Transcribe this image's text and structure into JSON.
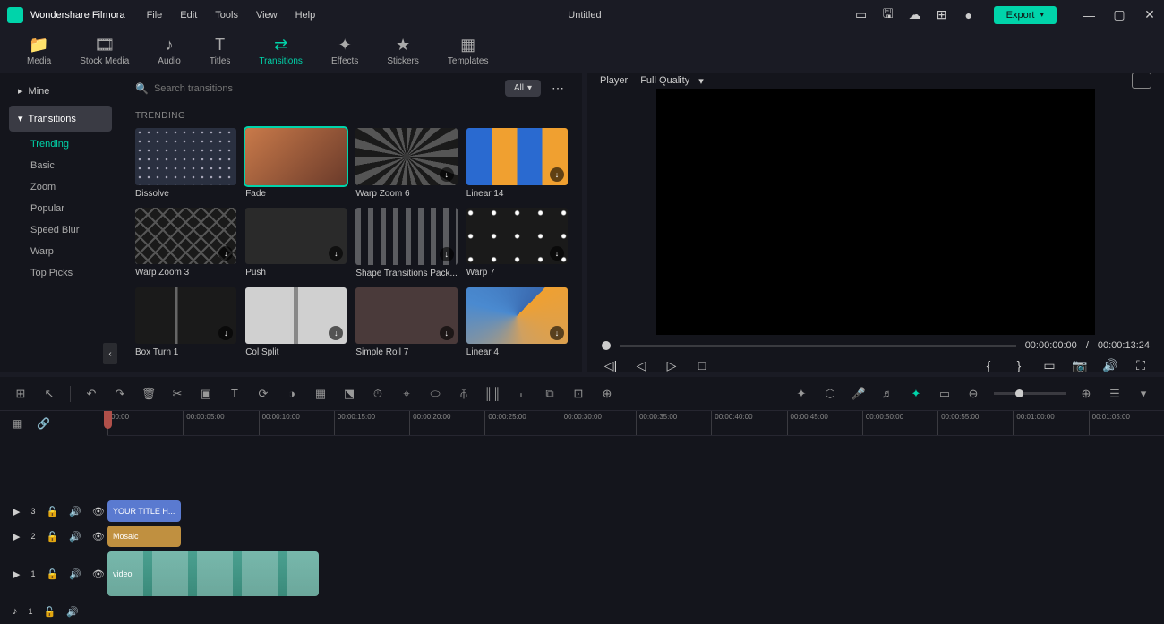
{
  "app": {
    "name": "Wondershare Filmora",
    "title": "Untitled",
    "export": "Export"
  },
  "menus": [
    "File",
    "Edit",
    "Tools",
    "View",
    "Help"
  ],
  "tabs": [
    "Media",
    "Stock Media",
    "Audio",
    "Titles",
    "Transitions",
    "Effects",
    "Stickers",
    "Templates"
  ],
  "active_tab": "Transitions",
  "sidebar": {
    "groups": [
      "Mine",
      "Transitions"
    ],
    "active_group": "Transitions",
    "subs": [
      "Trending",
      "Basic",
      "Zoom",
      "Popular",
      "Speed Blur",
      "Warp",
      "Top Picks"
    ],
    "active_sub": "Trending"
  },
  "search": {
    "placeholder": "Search transitions"
  },
  "filter": {
    "label": "All"
  },
  "section_title": "TRENDING",
  "selected_thumb": "Fade",
  "thumbs": [
    {
      "label": "Dissolve",
      "cls": "th-dissolve",
      "dl": false
    },
    {
      "label": "Fade",
      "cls": "th-fade",
      "dl": false
    },
    {
      "label": "Warp Zoom 6",
      "cls": "th-warp6",
      "dl": true
    },
    {
      "label": "Linear 14",
      "cls": "th-linear14",
      "dl": true
    },
    {
      "label": "Warp Zoom 3",
      "cls": "th-warp3",
      "dl": true
    },
    {
      "label": "Push",
      "cls": "th-push",
      "dl": true
    },
    {
      "label": "Shape Transitions Pack...",
      "cls": "th-shape",
      "dl": true
    },
    {
      "label": "Warp 7",
      "cls": "th-warp7",
      "dl": true
    },
    {
      "label": "Box Turn 1",
      "cls": "th-boxturn",
      "dl": true
    },
    {
      "label": "Col Split",
      "cls": "th-colsplit",
      "dl": true
    },
    {
      "label": "Simple Roll 7",
      "cls": "th-simpleroll",
      "dl": true
    },
    {
      "label": "Linear 4",
      "cls": "th-linear4",
      "dl": true
    }
  ],
  "player": {
    "tab": "Player",
    "quality": "Full Quality",
    "current": "00:00:00:00",
    "sep": "/",
    "duration": "00:00:13:24"
  },
  "ruler": [
    "00:00",
    "00:00:05:00",
    "00:00:10:00",
    "00:00:15:00",
    "00:00:20:00",
    "00:00:25:00",
    "00:00:30:00",
    "00:00:35:00",
    "00:00:40:00",
    "00:00:45:00",
    "00:00:50:00",
    "00:00:55:00",
    "00:01:00:00",
    "00:01:05:00"
  ],
  "tracks": {
    "t3": "3",
    "t2": "2",
    "t1v": "1",
    "t1a": "1",
    "title_clip": "YOUR TITLE H...",
    "mosaic_clip": "Mosaic",
    "video_clip": "video"
  }
}
